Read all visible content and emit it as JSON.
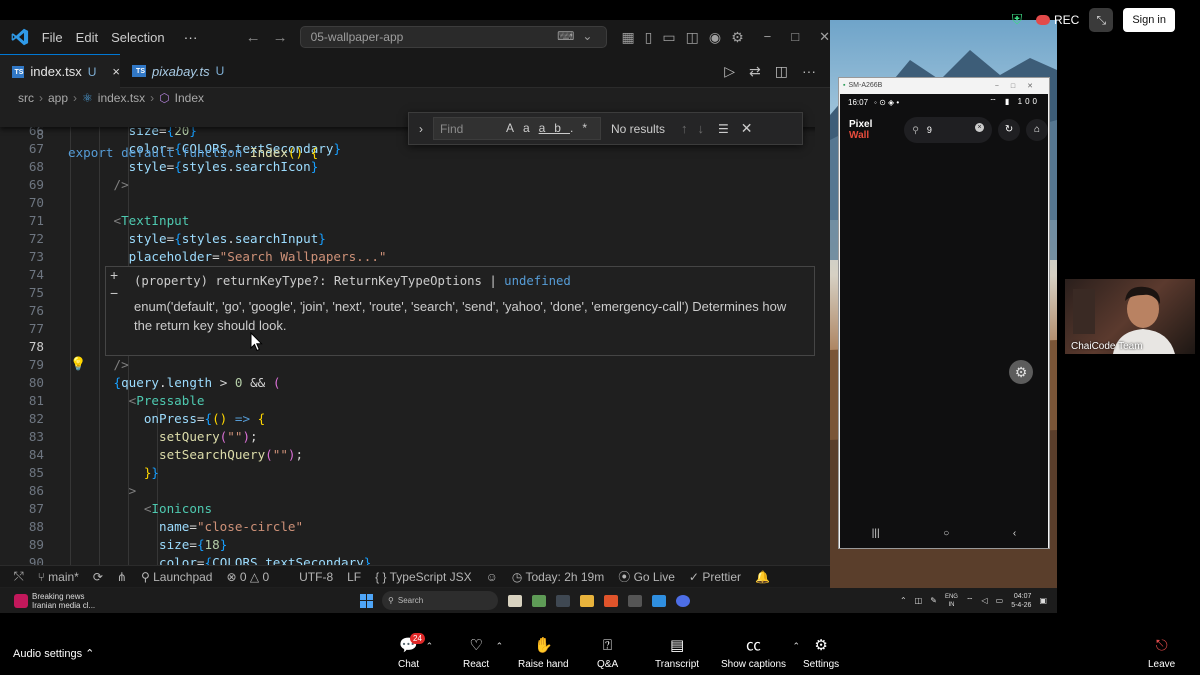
{
  "vscode": {
    "menu": [
      "File",
      "Edit",
      "Selection"
    ],
    "more": "···",
    "command_center": "05-wallpaper-app",
    "tabs": [
      {
        "name": "index.tsx",
        "modified": "U",
        "close": "×"
      },
      {
        "name": "pixabay.ts",
        "modified": "U"
      }
    ],
    "breadcrumb": [
      "src",
      "app",
      "index.tsx",
      "Index"
    ],
    "sticky": {
      "line": "8",
      "code": "export default function Index() {"
    },
    "find": {
      "placeholder": "Find",
      "opt_case": "Aa",
      "opt_word": "ab",
      "opt_regex": ".*",
      "result": "No results"
    },
    "hover": {
      "signature_prefix": "(property) returnKeyType?: ReturnKeyTypeOptions |",
      "signature_type": "undefined",
      "doc": "enum('default', 'go', 'google', 'join', 'next', 'route', 'search', 'send', 'yahoo', 'done', 'emergency-call') Determines how the return key should look."
    },
    "status": {
      "branch": "main*",
      "launchpad": "Launchpad",
      "problems": "⊗ 0 △ 0",
      "encoding": "UTF-8",
      "eol": "LF",
      "language": "TypeScript JSX",
      "time": "Today: 2h 19m",
      "golive": "Go Live",
      "prettier": "Prettier"
    }
  },
  "phone": {
    "window_title": "SM-A266B",
    "time": "16:07",
    "status_icons": "◦ ⊙ ◈ •",
    "signal": "⌔ ▮ 100",
    "brand_a": "Pixel",
    "brand_b": "Wall",
    "query": "9"
  },
  "webcam_label": "ChaiCode Team",
  "recording": {
    "label": "REC",
    "signin": "Sign in"
  },
  "taskbar": {
    "news_title": "Breaking news",
    "news_sub": "Iranian media cl...",
    "search": "Search",
    "lang_top": "ENG",
    "lang_bottom": "IN",
    "clock_time": "04:07",
    "clock_date": "5-4-26"
  },
  "zoom": {
    "audio_settings": "Audio settings",
    "chat_count": "24",
    "buttons": [
      "Chat",
      "React",
      "Raise hand",
      "Q&A",
      "Transcript",
      "Show captions",
      "Settings",
      "Leave"
    ]
  },
  "colors": {
    "accent": "#0078d4",
    "brand_accent": "#e74c3c",
    "rec": "#e24a4a"
  }
}
